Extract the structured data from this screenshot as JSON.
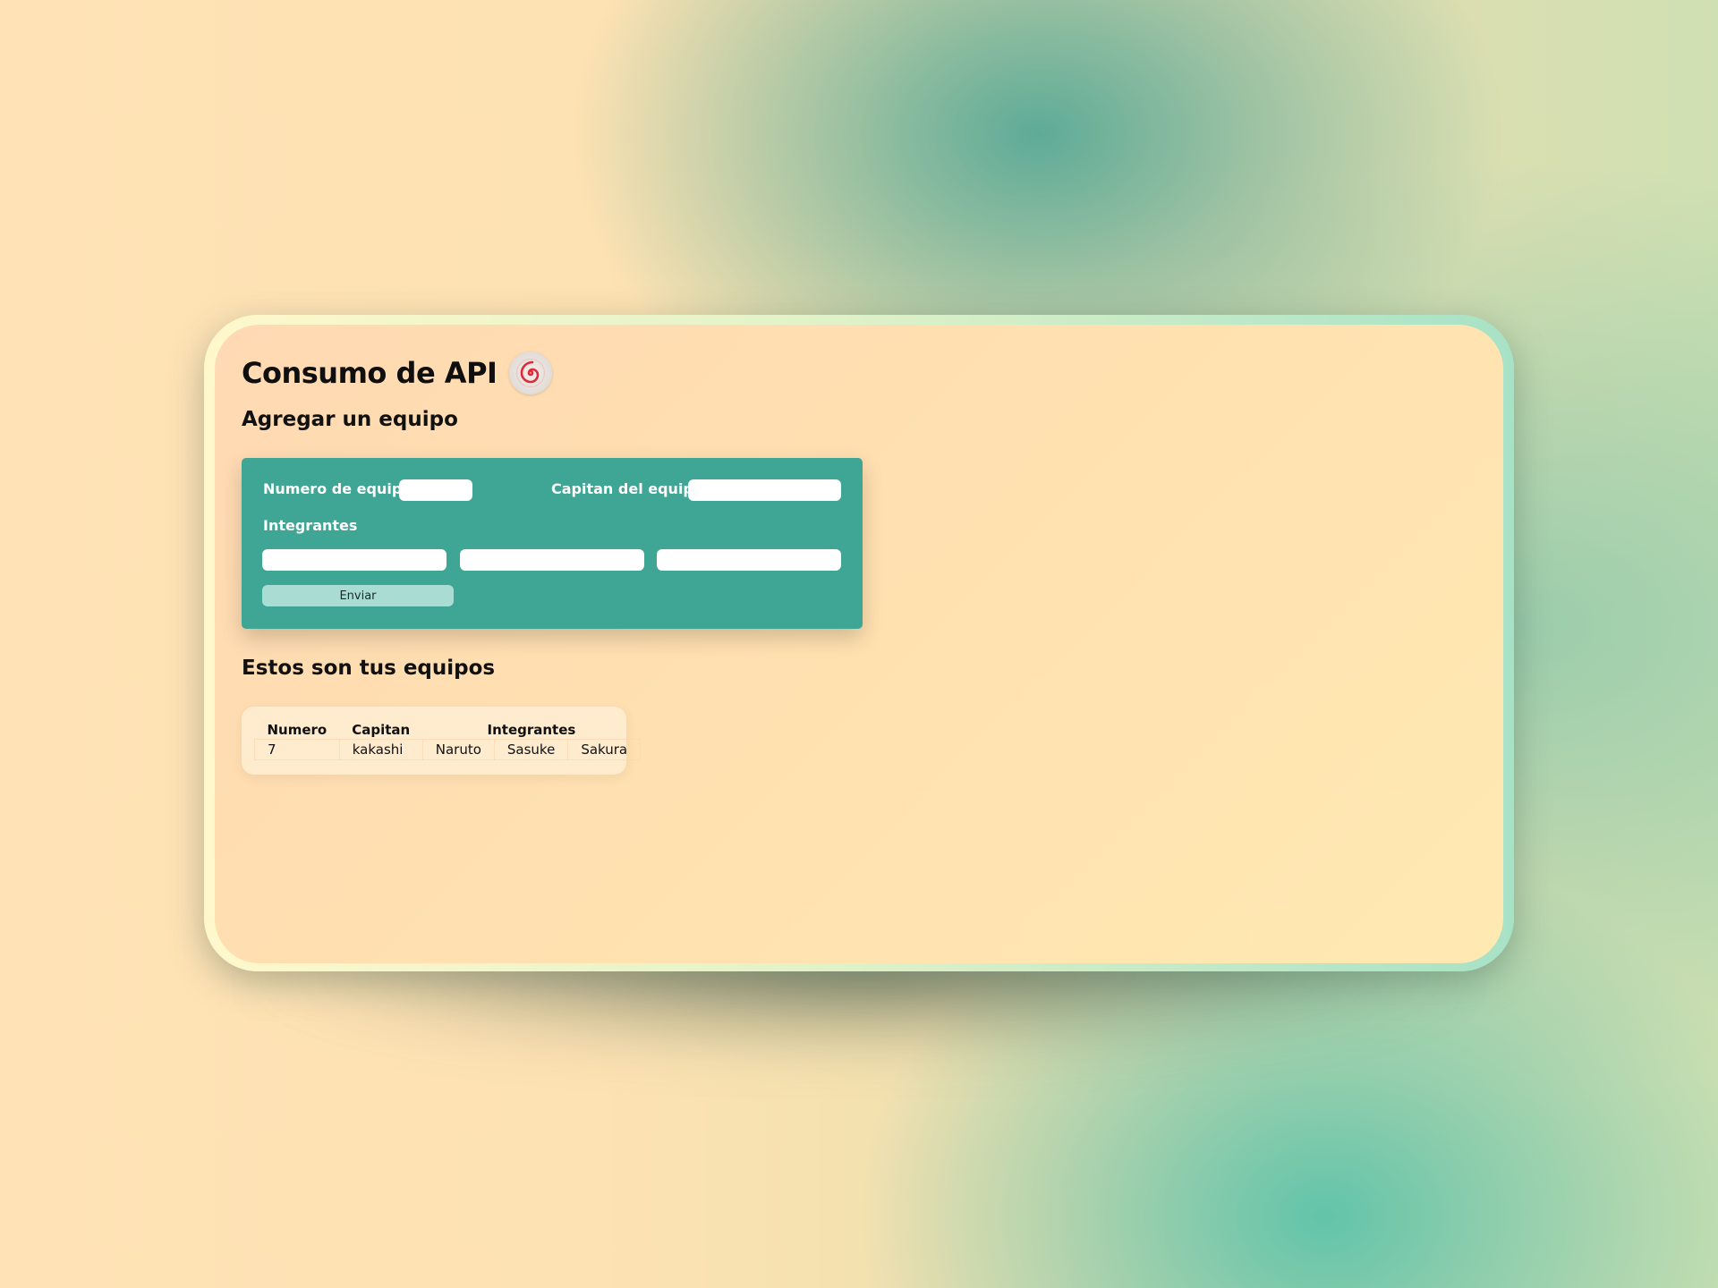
{
  "app": {
    "title": "Consumo de API",
    "logo_icon": "swirl-logo-icon"
  },
  "form": {
    "heading": "Agregar un equipo",
    "team_number_label": "Numero de equipo:",
    "team_number_value": "",
    "captain_label": "Capitan del equipo:",
    "captain_value": "",
    "members_label": "Integrantes",
    "member_1_value": "",
    "member_2_value": "",
    "member_3_value": "",
    "submit_label": "Enviar"
  },
  "teams": {
    "heading": "Estos son tus equipos",
    "columns": {
      "number": "Numero",
      "captain": "Capitan",
      "members": "Integrantes"
    },
    "rows": [
      {
        "number": "7",
        "captain": "kakashi",
        "member_1": "Naruto",
        "member_2": "Sasuke",
        "member_3": "Sakura"
      }
    ]
  },
  "colors": {
    "form_background": "#3fa595",
    "logo_swirl": "#e02a3a"
  }
}
